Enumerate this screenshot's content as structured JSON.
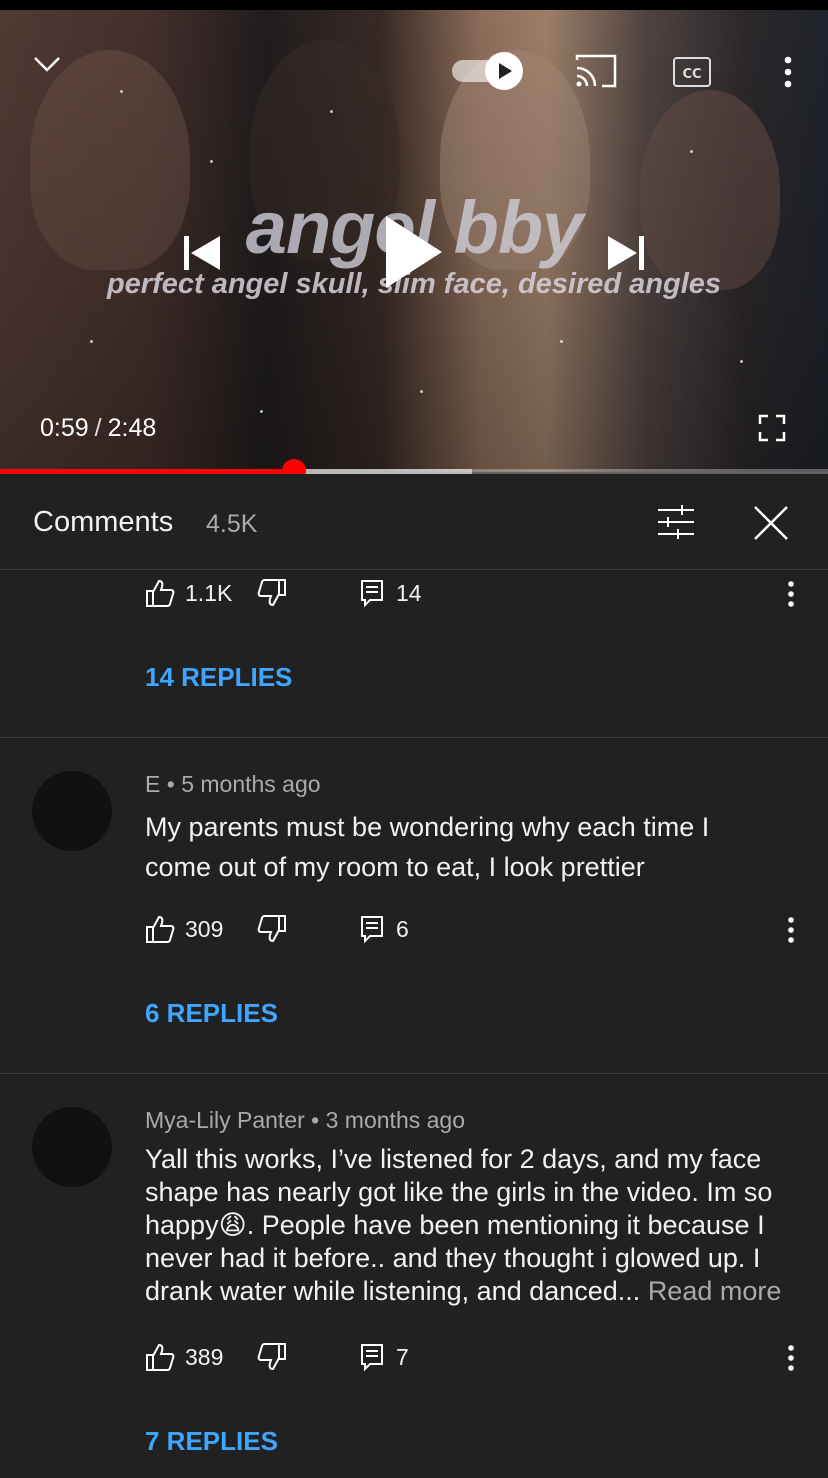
{
  "player": {
    "overlay_title": "angel bby",
    "overlay_subtitle": "perfect angel skull, slim face, desired angles",
    "current_time": "0:59",
    "separator": "/",
    "duration": "2:48",
    "cc_label": "CC",
    "progress_played_fraction": 0.355,
    "progress_buffered_fraction": 0.57,
    "accent_color": "#ff0000",
    "icons": [
      "chevron-down-icon",
      "autoplay-toggle-icon",
      "cast-icon",
      "captions-icon",
      "more-vert-icon",
      "previous-icon",
      "play-icon",
      "next-icon",
      "fullscreen-icon"
    ]
  },
  "comments_header": {
    "title": "Comments",
    "count": "4.5K",
    "icons": [
      "sort-sliders-icon",
      "close-icon"
    ]
  },
  "comments": [
    {
      "likes": "1.1K",
      "reply_count": "14",
      "replies_label": "14 REPLIES"
    },
    {
      "author": "E",
      "bullet": "•",
      "time": "5 months ago",
      "text_lines": [
        "My parents must be wondering why each time I",
        "come out of my room to eat, I look prettier"
      ],
      "likes": "309",
      "reply_count": "6",
      "replies_label": "6 REPLIES"
    },
    {
      "author": "Mya-Lily Panter",
      "bullet": "•",
      "time": "3 months ago",
      "text_lines": [
        "Yall this works, I’ve listened for 2 days, and my face",
        "shape has nearly got like the girls in the video. Im so",
        "happy😩. People have been mentioning it because I",
        "never had it before.. and they thought i glowed up. I",
        "drank water while listening, and danced..."
      ],
      "read_more": "Read more",
      "likes": "389",
      "reply_count": "7",
      "replies_label": "7 REPLIES"
    }
  ],
  "link_color": "#3ea6ff"
}
